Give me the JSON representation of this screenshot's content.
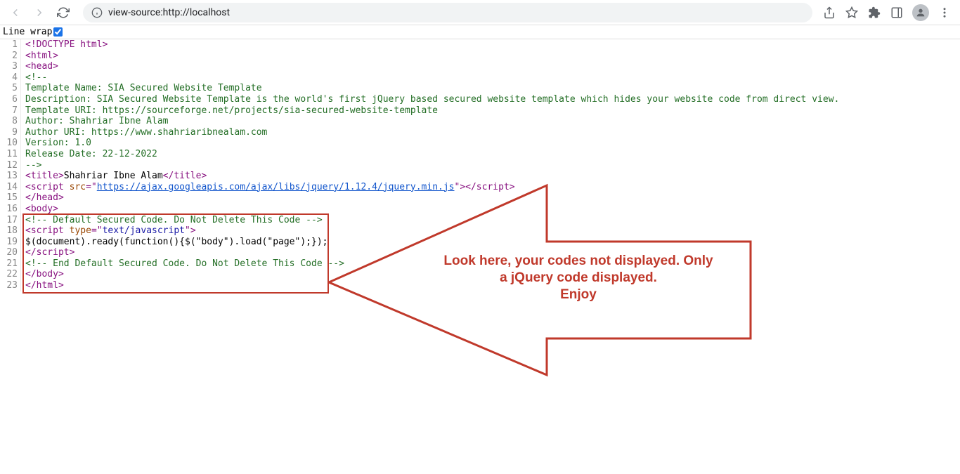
{
  "browser": {
    "url": "view-source:http://localhost"
  },
  "linewrap": {
    "label": "Line wrap",
    "checked": true
  },
  "source": {
    "rows": [
      {
        "n": 1,
        "spans": [
          {
            "t": "<!DOCTYPE html>",
            "c": "c-tag"
          }
        ]
      },
      {
        "n": 2,
        "spans": [
          {
            "t": "<html>",
            "c": "c-tag"
          }
        ]
      },
      {
        "n": 3,
        "spans": [
          {
            "t": "<head>",
            "c": "c-tag"
          }
        ]
      },
      {
        "n": 4,
        "spans": [
          {
            "t": "<!--",
            "c": "c-comment"
          }
        ]
      },
      {
        "n": 5,
        "spans": [
          {
            "t": "Template Name: SIA Secured Website Template",
            "c": "c-comment"
          }
        ]
      },
      {
        "n": 6,
        "spans": [
          {
            "t": "Description: SIA Secured Website Template is the world's first jQuery based secured website template which hides your website code from direct view.",
            "c": "c-comment"
          }
        ]
      },
      {
        "n": 7,
        "spans": [
          {
            "t": "Template URI: https://sourceforge.net/projects/sia-secured-website-template",
            "c": "c-comment"
          }
        ]
      },
      {
        "n": 8,
        "spans": [
          {
            "t": "Author: Shahriar Ibne Alam",
            "c": "c-comment"
          }
        ]
      },
      {
        "n": 9,
        "spans": [
          {
            "t": "Author URI: https://www.shahriaribnealam.com",
            "c": "c-comment"
          }
        ]
      },
      {
        "n": 10,
        "spans": [
          {
            "t": "Version: 1.0",
            "c": "c-comment"
          }
        ]
      },
      {
        "n": 11,
        "spans": [
          {
            "t": "Release Date: 22-12-2022",
            "c": "c-comment"
          }
        ]
      },
      {
        "n": 12,
        "spans": [
          {
            "t": "-->",
            "c": "c-comment"
          }
        ]
      },
      {
        "n": 13,
        "spans": [
          {
            "t": "<title>",
            "c": "c-tag"
          },
          {
            "t": "Shahriar Ibne Alam",
            "c": ""
          },
          {
            "t": "</title>",
            "c": "c-tag"
          }
        ]
      },
      {
        "n": 14,
        "spans": [
          {
            "t": "<script",
            "c": "c-tag"
          },
          {
            "t": " src",
            "c": "c-attr"
          },
          {
            "t": "=\"",
            "c": "c-tag"
          },
          {
            "t": "https://ajax.googleapis.com/ajax/libs/jquery/1.12.4/jquery.min.js",
            "c": "c-link"
          },
          {
            "t": "\"",
            "c": "c-tag"
          },
          {
            "t": ">",
            "c": "c-tag"
          },
          {
            "t": "</script>",
            "c": "c-tag"
          }
        ]
      },
      {
        "n": 15,
        "spans": [
          {
            "t": "</head>",
            "c": "c-tag"
          }
        ]
      },
      {
        "n": 16,
        "spans": [
          {
            "t": "<body>",
            "c": "c-tag"
          }
        ]
      },
      {
        "n": 17,
        "spans": [
          {
            "t": "<!-- Default Secured Code. Do Not Delete This Code -->",
            "c": "c-comment"
          }
        ]
      },
      {
        "n": 18,
        "spans": [
          {
            "t": "<script",
            "c": "c-tag"
          },
          {
            "t": " type",
            "c": "c-attr"
          },
          {
            "t": "=\"",
            "c": "c-tag"
          },
          {
            "t": "text/javascript",
            "c": "c-str"
          },
          {
            "t": "\"",
            "c": "c-tag"
          },
          {
            "t": ">",
            "c": "c-tag"
          }
        ]
      },
      {
        "n": 19,
        "spans": [
          {
            "t": "$(document).ready(function(){$(\"body\").load(\"page\");});",
            "c": ""
          }
        ]
      },
      {
        "n": 20,
        "spans": [
          {
            "t": "</script>",
            "c": "c-tag"
          }
        ]
      },
      {
        "n": 21,
        "spans": [
          {
            "t": "<!-- End Default Secured Code. Do Not Delete This Code -->",
            "c": "c-comment"
          }
        ]
      },
      {
        "n": 22,
        "spans": [
          {
            "t": "</body>",
            "c": "c-tag"
          }
        ]
      },
      {
        "n": 23,
        "spans": [
          {
            "t": "</html>",
            "c": "c-tag"
          }
        ]
      }
    ]
  },
  "callout": {
    "line1": "Look here, your codes not displayed. Only",
    "line2": "a jQuery code displayed.",
    "line3": "Enjoy"
  }
}
